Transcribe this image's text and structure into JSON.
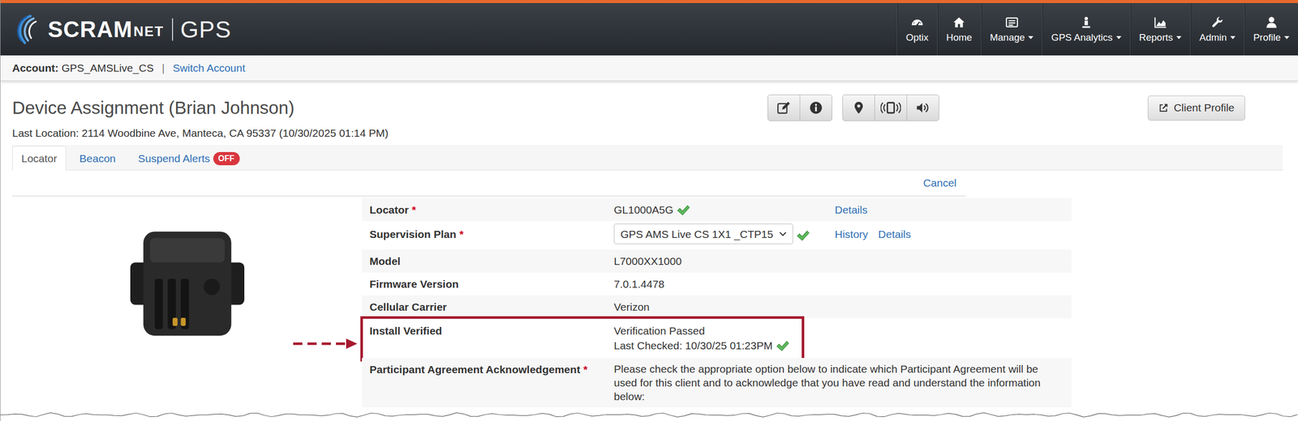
{
  "header": {
    "logo": {
      "brand": "SCRAM",
      "suffix": "NET",
      "product": "GPS"
    },
    "nav": [
      {
        "label": "Optix",
        "has_menu": false
      },
      {
        "label": "Home",
        "has_menu": false
      },
      {
        "label": "Manage",
        "has_menu": true
      },
      {
        "label": "GPS Analytics",
        "has_menu": true
      },
      {
        "label": "Reports",
        "has_menu": true
      },
      {
        "label": "Admin",
        "has_menu": true
      },
      {
        "label": "Profile",
        "has_menu": true
      }
    ]
  },
  "account_bar": {
    "label": "Account:",
    "value": "GPS_AMSLive_CS",
    "separator": "|",
    "link": "Switch Account"
  },
  "page": {
    "title": "Device Assignment (Brian Johnson)",
    "last_location": "Last Location: 2114 Woodbine Ave, Manteca, CA 95337 (10/30/2025 01:14 PM)",
    "client_profile_button": "Client Profile"
  },
  "tabs": [
    {
      "label": "Locator",
      "selected": true
    },
    {
      "label": "Beacon",
      "selected": false
    },
    {
      "label": "Suspend Alerts",
      "selected": false,
      "badge": "OFF"
    }
  ],
  "cancel_link": "Cancel",
  "details": [
    {
      "label": "Locator",
      "required_mark": "*",
      "kind": "text",
      "value": "GL1000A5G",
      "verified": true,
      "links": [
        "Details"
      ],
      "highlighted": false
    },
    {
      "label": "Supervision Plan",
      "required_mark": "*",
      "kind": "select",
      "value": "GPS AMS Live CS 1X1 _CTP15",
      "verified": true,
      "links": [
        "History",
        "Details"
      ],
      "highlighted": false
    },
    {
      "label": "Model",
      "kind": "text",
      "value": "L7000XX1000",
      "verified": false,
      "links": [],
      "highlighted": false
    },
    {
      "label": "Firmware Version",
      "kind": "text",
      "value": "7.0.1.4478",
      "verified": false,
      "links": [],
      "highlighted": false
    },
    {
      "label": "Cellular Carrier",
      "kind": "text",
      "value": "Verizon",
      "verified": false,
      "links": [],
      "highlighted": false
    },
    {
      "label": "Install Verified",
      "kind": "lines",
      "lines": [
        "Verification Passed",
        "Last Checked: 10/30/25 01:23PM"
      ],
      "verified": true,
      "links": [],
      "highlighted": true
    },
    {
      "label": "Participant Agreement Acknowledgement",
      "required_mark": "*",
      "kind": "paragraph",
      "value": "Please check the appropriate option below to indicate which Participant Agreement will be used for this client and to acknowledge that you have read and understand the information below:",
      "verified": false,
      "links": [],
      "highlighted": false
    }
  ]
}
